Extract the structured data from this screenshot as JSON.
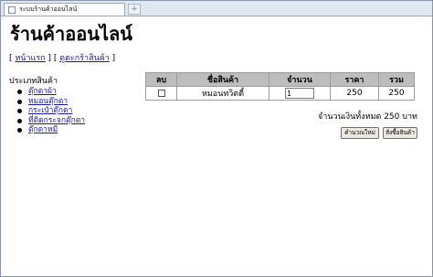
{
  "browser": {
    "tab_title": "ระบบร้านค้าออนไลน์",
    "new_tab_symbol": "+"
  },
  "page": {
    "title": "ร้านค้าออนไลน์",
    "nav": {
      "open_bracket_1": "[ ",
      "home_label": "หน้าแรก",
      "sep": " ] [ ",
      "cart_label": "ดูตะกร้าสินค้า",
      "close_bracket": " ]"
    },
    "category_heading": "ประเภทสินค้า",
    "categories": [
      {
        "label": "ตุ๊กตาผ้า"
      },
      {
        "label": "หมอนตุ๊กตา"
      },
      {
        "label": "กระเป๋าตุ๊กตา"
      },
      {
        "label": "ที่ติดกระจกตุ๊กตา"
      },
      {
        "label": "ตุ๊กตาหมี"
      }
    ]
  },
  "cart": {
    "headers": {
      "delete": "ลบ",
      "name": "ชื่อสินค้า",
      "qty": "จำนวน",
      "price": "ราคา",
      "sum": "รวม"
    },
    "rows": [
      {
        "name": "หมอนทวิตตี้",
        "qty": "1",
        "price": "250",
        "sum": "250"
      }
    ],
    "total_text": "จำนวนเงินทั้งหมด 250 บาท",
    "recalc_label": "คำนวณใหม่",
    "order_label": "สั่งซื้อสินค้า"
  }
}
